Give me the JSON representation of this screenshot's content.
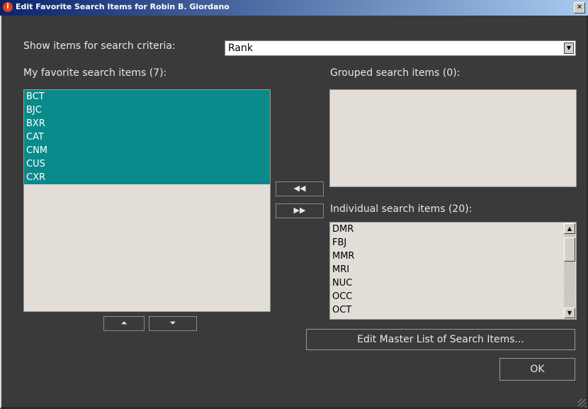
{
  "window": {
    "title": "Edit Favorite Search Items for Robin  B. Giordano",
    "title_icon": "info-icon",
    "close_glyph": "✕"
  },
  "criteria": {
    "label": "Show items for search criteria:",
    "selected": "Rank",
    "arrow": "▼"
  },
  "favorites": {
    "label": "My favorite search items (7):",
    "items": [
      "BCT",
      "BJC",
      "BXR",
      "CAT",
      "CNM",
      "CUS",
      "CXR"
    ],
    "move_up_glyph": "⏶",
    "move_down_glyph": "⏷"
  },
  "grouped": {
    "label": "Grouped search items (0):",
    "items": []
  },
  "transfer": {
    "add_glyph": "◀◀",
    "remove_glyph": "▶▶"
  },
  "individual": {
    "label": "Individual search items (20):",
    "visible_items": [
      "DMR",
      "FBJ",
      "MMR",
      "MRI",
      "NUC",
      "OCC",
      "OCT"
    ],
    "scroll_up": "▲",
    "scroll_down": "▼"
  },
  "buttons": {
    "edit_master": "Edit Master List of Search Items...",
    "ok": "OK"
  },
  "colors": {
    "selection": "#0a8a8a",
    "background": "#3a3a3a",
    "list_background": "#e2ddd7"
  }
}
